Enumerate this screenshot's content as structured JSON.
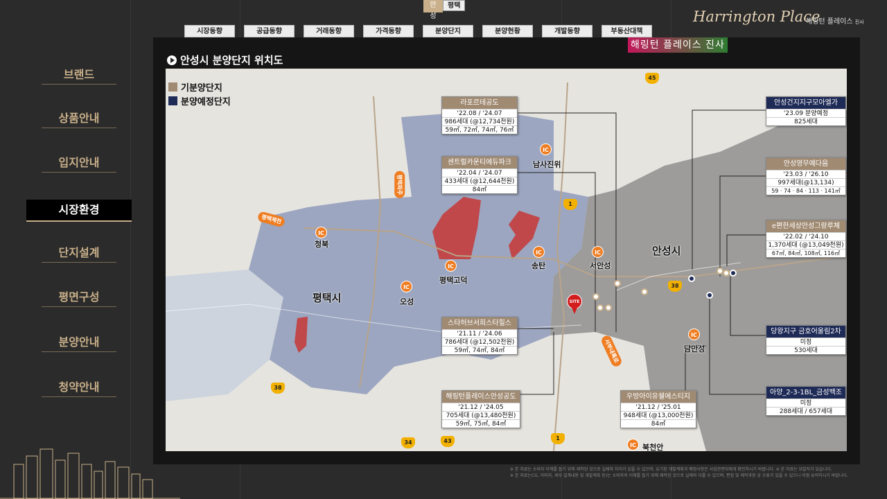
{
  "toggle": {
    "active": "안성",
    "other": "평택"
  },
  "tabs": [
    "시장동향",
    "공급동향",
    "거래동향",
    "가격동향",
    "분양단지",
    "분양현황",
    "개발동향",
    "부동산대책"
  ],
  "brand": {
    "script": "Harrington Place",
    "kr": "해링턴 플레이스",
    "kr_small": "진사"
  },
  "sidebar": [
    "브랜드",
    "상품안내",
    "입지안내",
    "시장환경",
    "단지설계",
    "평면구성",
    "분양안내",
    "청약안내"
  ],
  "sidebar_active": "시장환경",
  "badge": "해링턴 플레이스 진사",
  "map_title": "안성시 분양단지 위치도",
  "legend": [
    {
      "label": "기분양단지",
      "color": "#a08a72"
    },
    {
      "label": "분양예정단지",
      "color": "#1f2b57"
    }
  ],
  "places": [
    "평택시",
    "안성시",
    "청북",
    "평택고덕",
    "송탄",
    "서안성",
    "오성",
    "남사진위",
    "남안성",
    "북천안"
  ],
  "cards": [
    {
      "title": "라포르테공도",
      "lines": [
        "'22.08 / '24.07",
        "986세대 (@12,734천원)",
        "59㎡, 72㎡, 74㎡, 76㎡"
      ]
    },
    {
      "title": "센트럴카운티에듀파크",
      "lines": [
        "'22.04 / '24.07",
        "433세대 (@12,644천원)",
        "84㎡"
      ]
    },
    {
      "title": "스타허브서희스타힐스",
      "lines": [
        "'21.11 / '24.06",
        "786세대 (@12,502천원)",
        "59㎡, 74㎡, 84㎡"
      ]
    },
    {
      "title": "해링턴플레이스안성공도",
      "lines": [
        "'21.12 / '24.05",
        "705세대 (@13,480천원)",
        "59㎡, 75㎡, 84㎡"
      ]
    },
    {
      "title": "우방아이유쉘에스티지",
      "lines": [
        "'21.12 / '25.01",
        "948세대 (@13,000천원)",
        "84㎡"
      ]
    },
    {
      "title": "안성건지지구모아엘가",
      "lines": [
        "'23.09 분양예정",
        "825세대"
      ]
    },
    {
      "title": "안성영무예다음",
      "lines": [
        "'23.03 / '26.10",
        "997세대(@13,134)",
        "59 · 74 · 84 · 113 · 141㎡"
      ]
    },
    {
      "title": "e편한세상안성그랑루체",
      "lines": [
        "'22.02 / '24.10",
        "1,370세대 (@13,049천원)",
        "67㎡, 84㎡, 108㎡, 116㎡"
      ]
    },
    {
      "title": "당왕지구 금호어울림2차",
      "lines": [
        "미정",
        "530세대"
      ]
    },
    {
      "title": "아양_2-3-1BL_금성백조",
      "lines": [
        "미정",
        "288세대 / 657세대"
      ]
    }
  ],
  "ic_label": "IC",
  "site_label": "SITE",
  "roads": [
    "평택제천",
    "평택파주",
    "서부내륙로"
  ],
  "route_numbers": [
    "45",
    "38",
    "38",
    "34",
    "43",
    "1",
    "1"
  ],
  "disclaimer": [
    "※ 본 자료는 소비자 이해를 돕기 위해 제작된 것으로 실제와 차이가 있을 수 있으며, 유기된 개발계획과 예정사항은 사업관련자에게 확인하시기 바랍니다.   ※ 본 자료는 요발자가 있습니다.",
    "※ 본 자료는CG, 이미지, 세부 설계내용 및 개발계획 등)는 소비자의 이해를 돕기 위해 제작된 것으로 실제와 다를 수 있으며, 편집 및 제작과정 상 오류가 있을 수 있으니 이점 유의하시기 바랍니다."
  ]
}
